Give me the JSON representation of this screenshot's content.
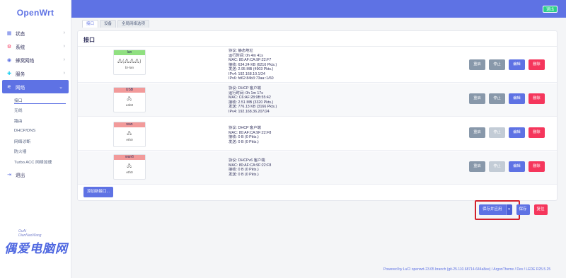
{
  "app": {
    "brand": "OpenWrt"
  },
  "header": {
    "logout_label": "退出"
  },
  "sidebar": {
    "items": [
      {
        "label": "状态",
        "icon": "dashboard-icon"
      },
      {
        "label": "系统",
        "icon": "gear-icon"
      },
      {
        "label": "蜂窝网络",
        "icon": "signal-icon"
      },
      {
        "label": "服务",
        "icon": "puzzle-icon"
      },
      {
        "label": "网络",
        "icon": "network-icon"
      }
    ],
    "subitems": [
      "接口",
      "无线",
      "路由",
      "DHCP/DNS",
      "网络诊断",
      "防火墙",
      "Turbo ACC 网络加速"
    ],
    "logout_label": "退出"
  },
  "watermark": {
    "line1": "OuAi",
    "line2": "DianNaoWang",
    "big": "偶爱电脑网"
  },
  "tabs": [
    "接口",
    "设备",
    "全局网络选项"
  ],
  "panel": {
    "title": "接口"
  },
  "interfaces": [
    {
      "name": "lan",
      "device": "br-lan",
      "badge_color": "#90e080",
      "icons": "🖧(🖧🖧🖧)",
      "info": [
        "协议: 静态地址",
        "运行时间: 0h 4m 41s",
        "MAC: 80:AF:CA:9F:22:F7",
        "接收: 634.24 KB (6216 Pkts.)",
        "发送: 2.95 MB (4903 Pkts.)",
        "IPv4: 192.168.10.1/24",
        "IPv6: fd62:84b3:73aa::1/60"
      ]
    },
    {
      "name": "USB",
      "device": "usb0",
      "badge_color": "#f29a9a",
      "icons": "🖧",
      "info": [
        "协议: DHCP 客户端",
        "运行时间: 0h 1m 17s",
        "MAC: C6:AF:28:9B:55:42",
        "接收: 2.51 MB (3320 Pkts.)",
        "发送: 776.13 KB (3166 Pkts.)",
        "IPv4: 192.168.36.207/24"
      ]
    },
    {
      "name": "wan",
      "device": "eth0",
      "badge_color": "#f29a9a",
      "icons": "🖧",
      "info": [
        "协议: DHCP 客户端",
        "MAC: 80:AF:CA:9F:22:F8",
        "接收: 0 B (0 Pkts.)",
        "发送: 0 B (0 Pkts.)"
      ]
    },
    {
      "name": "wan6",
      "device": "eth0",
      "badge_color": "#f29a9a",
      "icons": "🖧",
      "info": [
        "协议: DHCPv6 客户端",
        "MAC: 80:AF:CA:9F:22:F8",
        "接收: 0 B (0 Pkts.)",
        "发送: 0 B (0 Pkts.)"
      ]
    }
  ],
  "row_buttons": {
    "restart": "重启",
    "stop": "停止",
    "edit": "编辑",
    "delete": "删除"
  },
  "add_button": "添加新接口...",
  "actions": {
    "save_apply": "保存并应用",
    "caret": "▾",
    "save": "保存",
    "reset": "复位"
  },
  "footer": "Powered by LuCI openwrt-23.05 branch (git-25.110.68714-644a8ee) / ArgonTheme / Dev / LEDE R25.5.25"
}
